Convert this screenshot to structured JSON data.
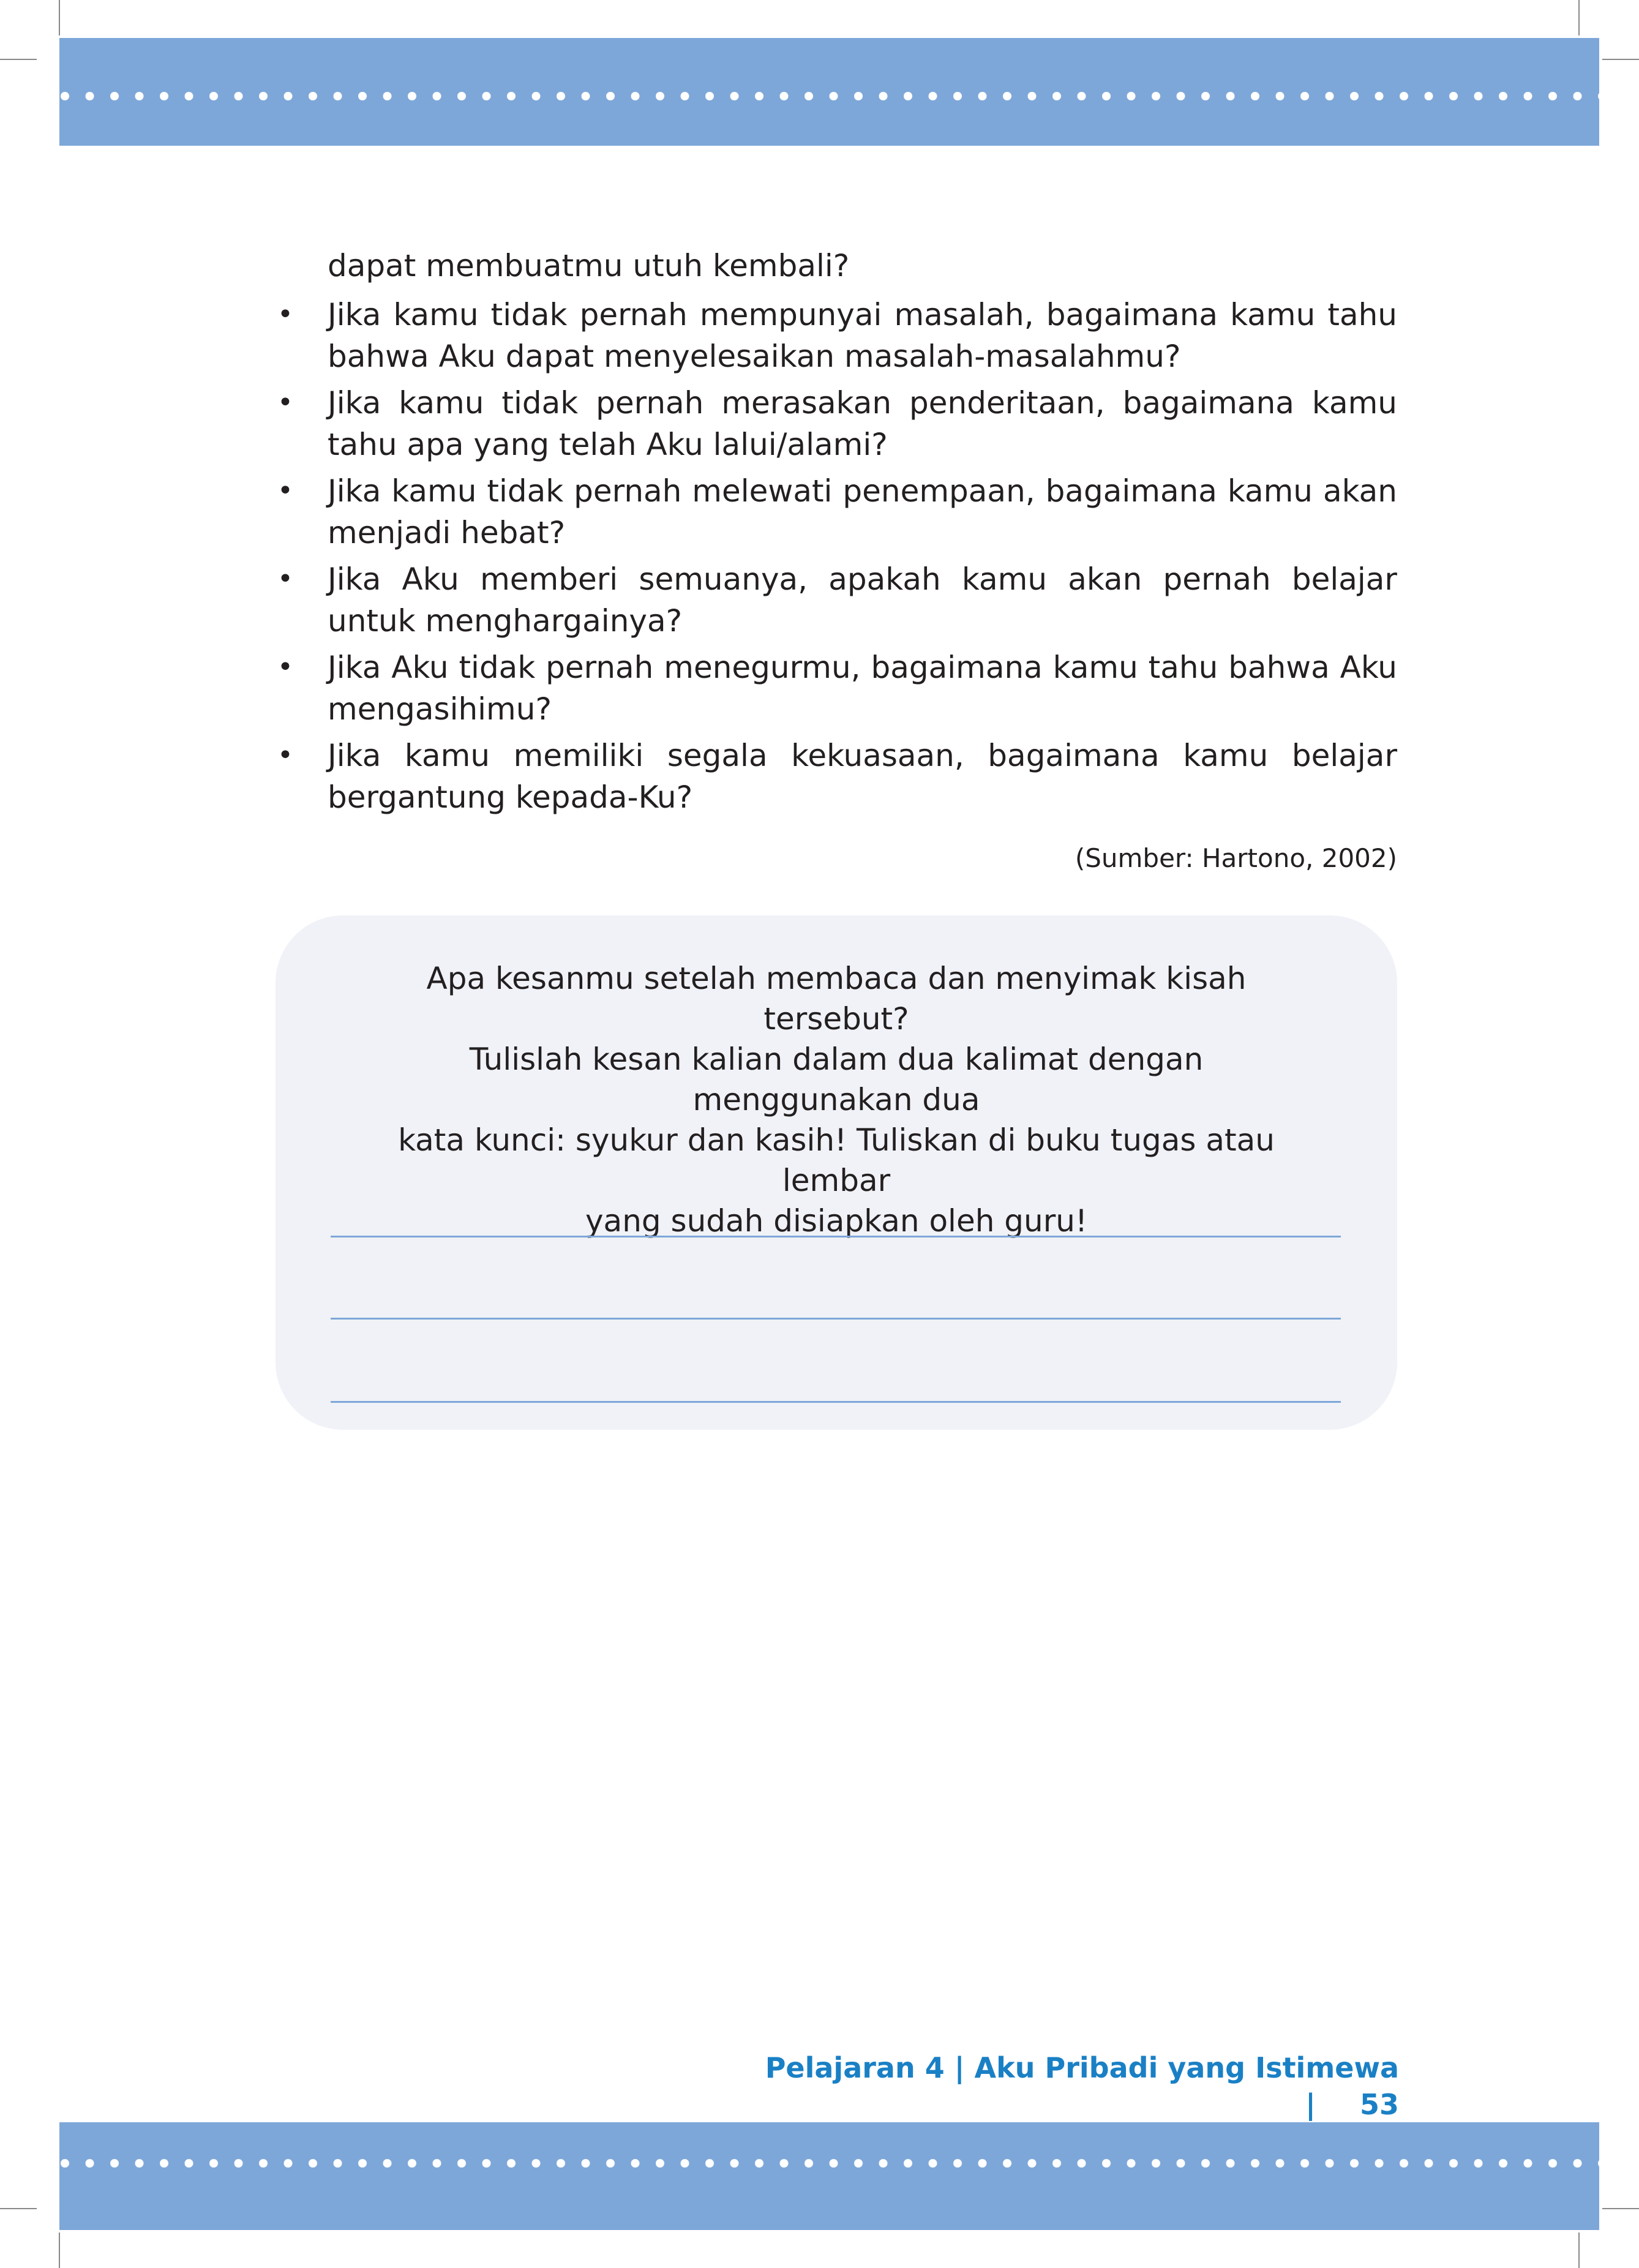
{
  "body": {
    "continuation": "dapat membuatmu utuh kembali?",
    "bullet_symbol": "•",
    "bullets": [
      "Jika kamu tidak pernah mempunyai masalah, bagaimana kamu tahu bahwa Aku dapat menyelesaikan masalah-masalahmu?",
      "Jika kamu tidak pernah merasakan penderitaan, bagaimana kamu tahu apa yang telah Aku lalui/alami?",
      "Jika kamu tidak pernah melewati penempaan, bagaimana kamu akan menjadi hebat?",
      "Jika Aku memberi semuanya, apakah kamu akan pernah belajar untuk menghargainya?",
      "Jika Aku tidak pernah menegurmu, bagaimana kamu tahu bahwa Aku mengasihimu?",
      "Jika kamu memiliki segala kekuasaan, bagaimana kamu belajar bergantung kepada-Ku?"
    ],
    "source": "(Sumber: Hartono, 2002)"
  },
  "activity_box": {
    "prompt_lines": [
      "Apa kesanmu setelah membaca dan menyimak kisah tersebut?",
      "Tulislah kesan kalian dalam dua kalimat dengan menggunakan dua",
      "kata kunci: syukur dan kasih! Tuliskan di buku tugas atau lembar",
      "yang sudah disiapkan oleh guru!"
    ]
  },
  "footer": {
    "chapter": "Pelajaran 4 | Aku Pribadi yang Istimewa |",
    "page_number": "53"
  },
  "colors": {
    "band": "#7da7d9",
    "box_background": "#f0f2f7",
    "footer_text": "#1a80c5",
    "write_line": "#7da7d9"
  }
}
